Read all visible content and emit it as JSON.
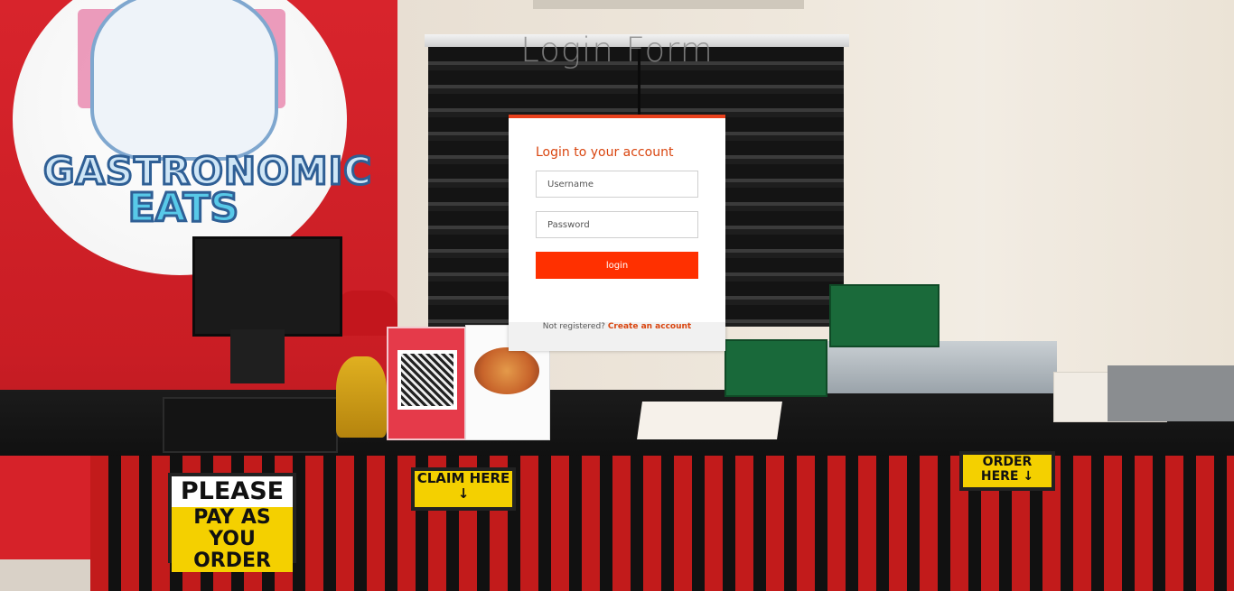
{
  "page": {
    "title": "Login Form"
  },
  "login_card": {
    "heading": "Login to your account",
    "username_placeholder": "Username",
    "password_placeholder": "Password",
    "login_button": "login",
    "footer_text": "Not registered?",
    "create_account_link": "Create an account",
    "accent_color": "#e8401c",
    "button_color": "#ff3000"
  },
  "background": {
    "logo_line1": "GASTRONOMIC",
    "logo_line2": "EATS",
    "sign_please_top": "PLEASE",
    "sign_please_bottom": "PAY AS YOU ORDER",
    "sign_claim": "CLAIM HERE ↓",
    "sign_order": "ORDER HERE ↓"
  }
}
